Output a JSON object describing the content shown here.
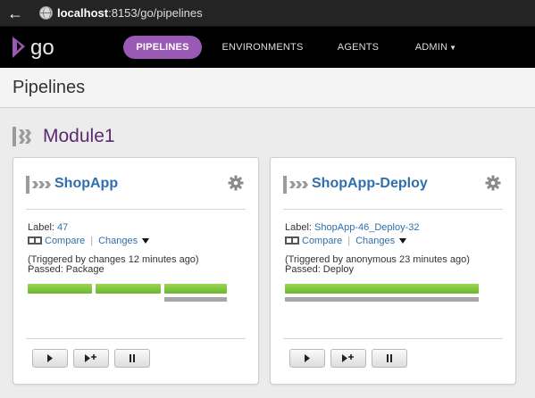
{
  "browser": {
    "url_host": "localhost",
    "url_rest": ":8153/go/pipelines"
  },
  "nav": {
    "logo_text": "go",
    "items": [
      {
        "label": "PIPELINES",
        "active": true
      },
      {
        "label": "ENVIRONMENTS",
        "active": false
      },
      {
        "label": "AGENTS",
        "active": false
      },
      {
        "label": "ADMIN",
        "active": false
      }
    ]
  },
  "page": {
    "title": "Pipelines"
  },
  "group": {
    "name": "Module1"
  },
  "pipelines": [
    {
      "name": "ShopApp",
      "label_prefix": "Label:",
      "label_value": "47",
      "compare": "Compare",
      "changes": "Changes",
      "trigger": "(Triggered by changes 12 minutes ago)",
      "passed": "Passed: Package",
      "stages": 3
    },
    {
      "name": "ShopApp-Deploy",
      "label_prefix": "Label:",
      "label_value": "ShopApp-46_Deploy-32",
      "compare": "Compare",
      "changes": "Changes",
      "trigger": "(Triggered by anonymous 23 minutes ago)",
      "passed": "Passed: Deploy",
      "stages": 1
    }
  ],
  "colors": {
    "accent": "#9a59b5",
    "link": "#2f6fae",
    "stage_passed": "#7cc13a",
    "group_title": "#5a2b6e"
  },
  "icons": [
    "back-arrow-icon",
    "globe-icon",
    "go-logo-icon",
    "pipeline-group-icon",
    "pipeline-icon",
    "gear-icon",
    "compare-icon",
    "chevron-down-icon",
    "play-icon",
    "play-with-options-icon",
    "pause-icon"
  ]
}
